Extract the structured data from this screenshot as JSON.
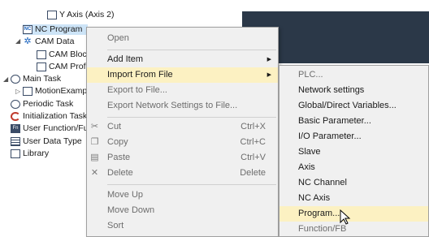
{
  "tree": {
    "items": [
      {
        "label": "Y Axis (Axis 2)"
      },
      {
        "label": "NC Program"
      },
      {
        "label": "CAM Data"
      },
      {
        "label": "CAM Bloc"
      },
      {
        "label": "CAM Profi"
      },
      {
        "label": "Main Task"
      },
      {
        "label": "MotionExamp"
      },
      {
        "label": "Periodic Task"
      },
      {
        "label": "Initialization Task"
      },
      {
        "label": "User Function/Fu"
      },
      {
        "label": "User Data Type"
      },
      {
        "label": "Library"
      }
    ]
  },
  "context_menu": {
    "items": [
      {
        "label": "Open",
        "disabled": true
      },
      {
        "label": "Add Item",
        "submenu": true
      },
      {
        "label": "Import From File",
        "submenu": true,
        "highlighted": true
      },
      {
        "label": "Export to File...",
        "disabled": true
      },
      {
        "label": "Export Network Settings to File...",
        "disabled": true
      },
      {
        "label": "Cut",
        "shortcut": "Ctrl+X",
        "disabled": true,
        "icon": "scissors-icon"
      },
      {
        "label": "Copy",
        "shortcut": "Ctrl+C",
        "disabled": true,
        "icon": "copy-icon"
      },
      {
        "label": "Paste",
        "shortcut": "Ctrl+V",
        "disabled": true,
        "icon": "paste-icon"
      },
      {
        "label": "Delete",
        "shortcut": "Delete",
        "disabled": true,
        "icon": "delete-icon"
      },
      {
        "label": "Move Up",
        "disabled": true
      },
      {
        "label": "Move Down",
        "disabled": true
      },
      {
        "label": "Sort",
        "disabled": true
      }
    ]
  },
  "submenu": {
    "items": [
      {
        "label": "PLC...",
        "disabled": true
      },
      {
        "label": "Network settings"
      },
      {
        "label": "Global/Direct Variables..."
      },
      {
        "label": "Basic Parameter..."
      },
      {
        "label": "I/O Parameter..."
      },
      {
        "label": "Slave"
      },
      {
        "label": "Axis"
      },
      {
        "label": "NC Channel"
      },
      {
        "label": "NC Axis"
      },
      {
        "label": "Program...",
        "highlighted": true
      },
      {
        "label": "Function/FB",
        "disabled": true
      }
    ]
  },
  "colors": {
    "menu_bg": "#f0f0f0",
    "highlight": "#fcf1c2",
    "dark_panel": "#2b3848",
    "selection": "#cde4f7"
  }
}
